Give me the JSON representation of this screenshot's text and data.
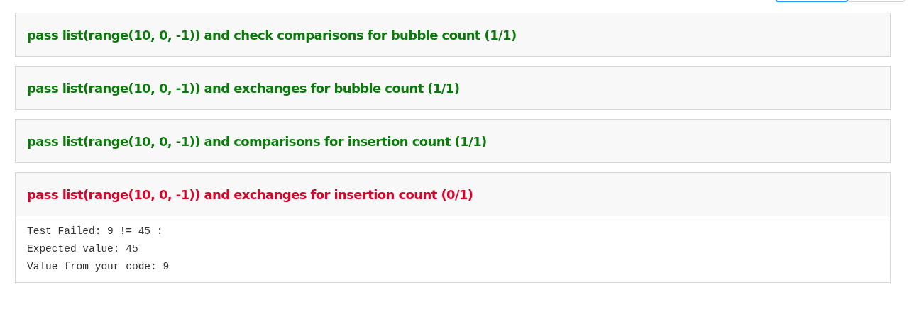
{
  "toolbar_buttons": [
    {
      "selected": true
    },
    {
      "selected": false
    }
  ],
  "results": [
    {
      "title": "pass list(range(10, 0, -1)) and check comparisons for bubble count (1/1)",
      "passed": true
    },
    {
      "title": "pass list(range(10, 0, -1)) and exchanges for bubble count (1/1)",
      "passed": true
    },
    {
      "title": "pass list(range(10, 0, -1)) and comparisons for insertion count (1/1)",
      "passed": true
    },
    {
      "title": "pass list(range(10, 0, -1)) and exchanges for insertion count (0/1)",
      "passed": false,
      "details": [
        "Test Failed: 9 != 45 :",
        "Expected value: 45",
        "Value from your code: 9"
      ]
    }
  ]
}
